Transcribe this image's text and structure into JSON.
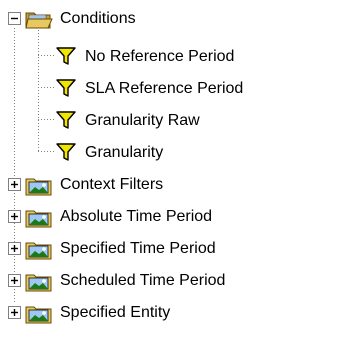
{
  "tree": {
    "root": {
      "label": "Conditions",
      "icon": "open-folder-icon",
      "expanded": true
    },
    "leaves": [
      {
        "label": "No Reference Period",
        "icon": "filter-funnel-icon"
      },
      {
        "label": "SLA Reference Period",
        "icon": "filter-funnel-icon"
      },
      {
        "label": "Granularity Raw",
        "icon": "filter-funnel-icon"
      },
      {
        "label": "Granularity",
        "icon": "filter-funnel-icon"
      }
    ],
    "folders": [
      {
        "label": "Context Filters",
        "icon": "image-folder-icon",
        "expanded": false
      },
      {
        "label": "Absolute Time Period",
        "icon": "image-folder-icon",
        "expanded": false
      },
      {
        "label": "Specified Time Period",
        "icon": "image-folder-icon",
        "expanded": false
      },
      {
        "label": "Scheduled Time Period",
        "icon": "image-folder-icon",
        "expanded": false
      },
      {
        "label": "Specified Entity",
        "icon": "image-folder-icon",
        "expanded": false
      }
    ]
  },
  "colors": {
    "funnel": "#f2e600",
    "funnel_outline": "#000000",
    "folder": "#e8c860",
    "folder_dark": "#8a6a10",
    "image_sky": "#9fc8f0",
    "image_hill": "#1a7a1a",
    "tree_lines": "#808080"
  }
}
